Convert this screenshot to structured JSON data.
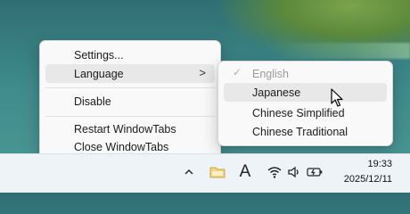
{
  "context_menu": {
    "items": [
      {
        "label": "Settings...",
        "type": "item"
      },
      {
        "label": "Language",
        "type": "submenu"
      },
      {
        "type": "separator"
      },
      {
        "label": "Disable",
        "type": "item"
      },
      {
        "type": "separator"
      },
      {
        "label": "Restart WindowTabs",
        "type": "item"
      },
      {
        "label": "Close WindowTabs",
        "type": "item"
      }
    ],
    "highlighted": "Language",
    "submenu_arrow": ">"
  },
  "language_submenu": {
    "items": [
      {
        "label": "English",
        "checked": true,
        "disabled": true
      },
      {
        "label": "Japanese",
        "checked": false,
        "disabled": false
      },
      {
        "label": "Chinese Simplified",
        "checked": false,
        "disabled": false
      },
      {
        "label": "Chinese Traditional",
        "checked": false,
        "disabled": false
      }
    ],
    "hovered": "Japanese",
    "check_glyph": "✓"
  },
  "taskbar": {
    "tray_icons": [
      "chevron-up-icon",
      "folder-icon",
      "font-a-icon",
      "wifi-icon",
      "volume-icon",
      "battery-icon"
    ],
    "font_icon_text": "A",
    "clock": {
      "time": "19:33",
      "date": "2025/12/11"
    }
  }
}
